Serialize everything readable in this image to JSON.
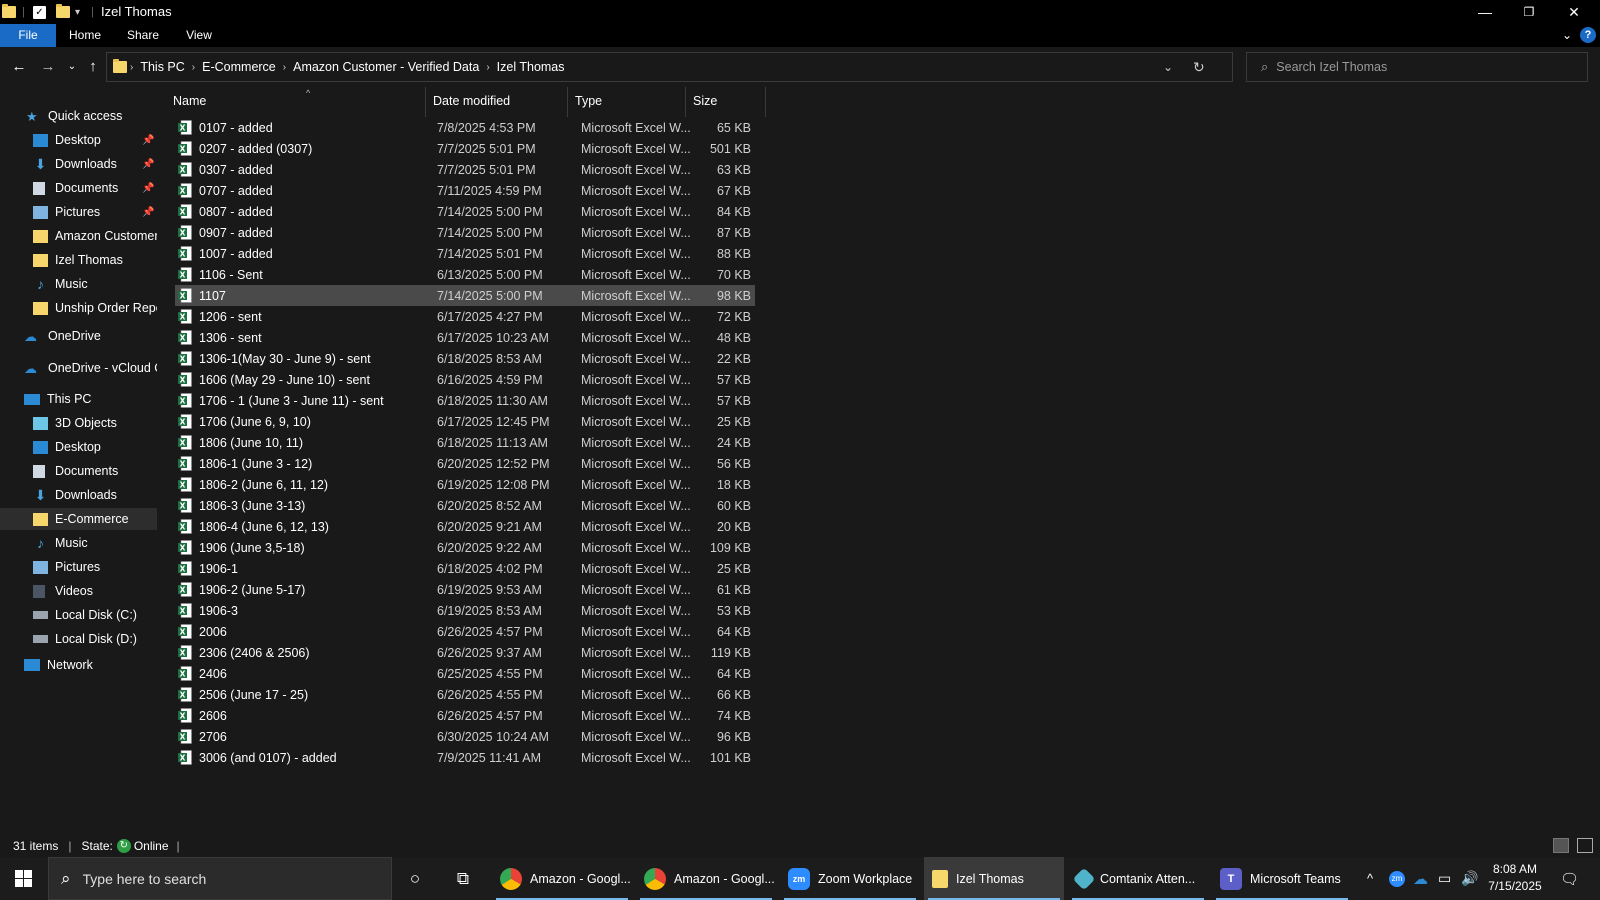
{
  "window": {
    "title": "Izel Thomas",
    "controls": {
      "minimize": "—",
      "restore": "❐",
      "close": "✕"
    }
  },
  "ribbon": {
    "tabs": [
      "File",
      "Home",
      "Share",
      "View"
    ]
  },
  "address": {
    "crumbs": [
      "This PC",
      "E-Commerce",
      "Amazon Customer - Verified Data",
      "Izel Thomas"
    ]
  },
  "search": {
    "placeholder": "Search Izel Thomas"
  },
  "navpane": {
    "quick_access": "Quick access",
    "quick_items": [
      "Desktop",
      "Downloads",
      "Documents",
      "Pictures",
      "Amazon Customer",
      "Izel Thomas",
      "Music",
      "Unship Order Repor"
    ],
    "onedrive": "OneDrive",
    "onedrive_vcloud": "OneDrive - vCloud Cl",
    "this_pc": "This PC",
    "pc_items": [
      "3D Objects",
      "Desktop",
      "Documents",
      "Downloads",
      "E-Commerce",
      "Music",
      "Pictures",
      "Videos",
      "Local Disk (C:)",
      "Local Disk (D:)"
    ],
    "network": "Network"
  },
  "columns": {
    "name": "Name",
    "date": "Date modified",
    "type": "Type",
    "size": "Size"
  },
  "files": [
    {
      "name": "0107 - added",
      "date": "7/8/2025 4:53 PM",
      "type": "Microsoft Excel W...",
      "size": "65 KB"
    },
    {
      "name": "0207 - added (0307)",
      "date": "7/7/2025 5:01 PM",
      "type": "Microsoft Excel W...",
      "size": "501 KB"
    },
    {
      "name": "0307 - added",
      "date": "7/7/2025 5:01 PM",
      "type": "Microsoft Excel W...",
      "size": "63 KB"
    },
    {
      "name": "0707 - added",
      "date": "7/11/2025 4:59 PM",
      "type": "Microsoft Excel W...",
      "size": "67 KB"
    },
    {
      "name": "0807 - added",
      "date": "7/14/2025 5:00 PM",
      "type": "Microsoft Excel W...",
      "size": "84 KB"
    },
    {
      "name": "0907 - added",
      "date": "7/14/2025 5:00 PM",
      "type": "Microsoft Excel W...",
      "size": "87 KB"
    },
    {
      "name": "1007 - added",
      "date": "7/14/2025 5:01 PM",
      "type": "Microsoft Excel W...",
      "size": "88 KB"
    },
    {
      "name": "1106 - Sent",
      "date": "6/13/2025 5:00 PM",
      "type": "Microsoft Excel W...",
      "size": "70 KB"
    },
    {
      "name": "1107",
      "date": "7/14/2025 5:00 PM",
      "type": "Microsoft Excel W...",
      "size": "98 KB",
      "selected": true
    },
    {
      "name": "1206 - sent",
      "date": "6/17/2025 4:27 PM",
      "type": "Microsoft Excel W...",
      "size": "72 KB"
    },
    {
      "name": "1306 - sent",
      "date": "6/17/2025 10:23 AM",
      "type": "Microsoft Excel W...",
      "size": "48 KB"
    },
    {
      "name": "1306-1(May 30 - June 9) - sent",
      "date": "6/18/2025 8:53 AM",
      "type": "Microsoft Excel W...",
      "size": "22 KB"
    },
    {
      "name": "1606 (May 29 - June 10) - sent",
      "date": "6/16/2025 4:59 PM",
      "type": "Microsoft Excel W...",
      "size": "57 KB"
    },
    {
      "name": "1706 - 1 (June 3 - June 11) - sent",
      "date": "6/18/2025 11:30 AM",
      "type": "Microsoft Excel W...",
      "size": "57 KB"
    },
    {
      "name": "1706 (June 6, 9, 10)",
      "date": "6/17/2025 12:45 PM",
      "type": "Microsoft Excel W...",
      "size": "25 KB"
    },
    {
      "name": "1806 (June 10, 11)",
      "date": "6/18/2025 11:13 AM",
      "type": "Microsoft Excel W...",
      "size": "24 KB"
    },
    {
      "name": "1806-1 (June 3 - 12)",
      "date": "6/20/2025 12:52 PM",
      "type": "Microsoft Excel W...",
      "size": "56 KB"
    },
    {
      "name": "1806-2 (June 6, 11, 12)",
      "date": "6/19/2025 12:08 PM",
      "type": "Microsoft Excel W...",
      "size": "18 KB"
    },
    {
      "name": "1806-3 (June 3-13)",
      "date": "6/20/2025 8:52 AM",
      "type": "Microsoft Excel W...",
      "size": "60 KB"
    },
    {
      "name": "1806-4 (June 6, 12, 13)",
      "date": "6/20/2025 9:21 AM",
      "type": "Microsoft Excel W...",
      "size": "20 KB"
    },
    {
      "name": "1906 (June 3,5-18)",
      "date": "6/20/2025 9:22 AM",
      "type": "Microsoft Excel W...",
      "size": "109 KB"
    },
    {
      "name": "1906-1",
      "date": "6/18/2025 4:02 PM",
      "type": "Microsoft Excel W...",
      "size": "25 KB"
    },
    {
      "name": "1906-2 (June 5-17)",
      "date": "6/19/2025 9:53 AM",
      "type": "Microsoft Excel W...",
      "size": "61 KB"
    },
    {
      "name": "1906-3",
      "date": "6/19/2025 8:53 AM",
      "type": "Microsoft Excel W...",
      "size": "53 KB"
    },
    {
      "name": "2006",
      "date": "6/26/2025 4:57 PM",
      "type": "Microsoft Excel W...",
      "size": "64 KB"
    },
    {
      "name": "2306 (2406 & 2506)",
      "date": "6/26/2025 9:37 AM",
      "type": "Microsoft Excel W...",
      "size": "119 KB"
    },
    {
      "name": "2406",
      "date": "6/25/2025 4:55 PM",
      "type": "Microsoft Excel W...",
      "size": "64 KB"
    },
    {
      "name": "2506 (June 17 - 25)",
      "date": "6/26/2025 4:55 PM",
      "type": "Microsoft Excel W...",
      "size": "66 KB"
    },
    {
      "name": "2606",
      "date": "6/26/2025 4:57 PM",
      "type": "Microsoft Excel W...",
      "size": "74 KB"
    },
    {
      "name": "2706",
      "date": "6/30/2025 10:24 AM",
      "type": "Microsoft Excel W...",
      "size": "96 KB"
    },
    {
      "name": "3006 (and 0107) - added",
      "date": "7/9/2025 11:41 AM",
      "type": "Microsoft Excel W...",
      "size": "101 KB"
    }
  ],
  "status": {
    "items": "31 items",
    "state_label": "State:",
    "state_value": "Online"
  },
  "taskbar": {
    "search_placeholder": "Type here to search",
    "apps": [
      {
        "label": "Amazon - Googl...",
        "icon": "chrome-icon",
        "color": "#4285f4"
      },
      {
        "label": "Amazon - Googl...",
        "icon": "chrome-icon",
        "color": "#4285f4"
      },
      {
        "label": "Zoom Workplace",
        "icon": "zoom-icon",
        "color": "#2d8cff"
      },
      {
        "label": "Izel Thomas",
        "icon": "file-explorer-icon",
        "color": "#f7d66b",
        "active": true
      },
      {
        "label": "Comtanix Atten...",
        "icon": "comtanix-icon",
        "color": "#4fb3c9"
      },
      {
        "label": "Microsoft Teams",
        "icon": "teams-icon",
        "color": "#5b5fc7"
      }
    ],
    "clock_time": "8:08 AM",
    "clock_date": "7/15/2025"
  },
  "colors": {
    "accent": "#1a6bc6",
    "folder": "#f7d66b",
    "excel": "#1d6f42",
    "selected_row": "#4a4a4a"
  }
}
